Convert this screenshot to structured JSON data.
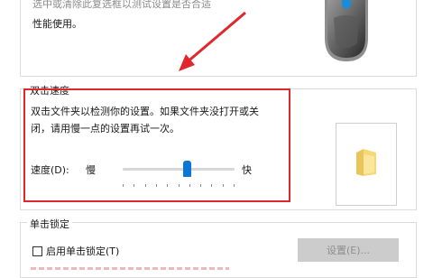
{
  "top_section": {
    "line1": "选中或清除此复选框以测试设置是否合适",
    "line2": "性能使用。"
  },
  "double_click": {
    "group_title": "双击速度",
    "desc_line1": "双击文件夹以检测你的设置。如果文件夹没打开或关",
    "desc_line2": "闭，请用慢一点的设置再试一次。",
    "speed_label": "速度(D):",
    "slow_label": "慢",
    "fast_label": "快",
    "slider_fraction": 0.58
  },
  "click_lock": {
    "group_title": "单击锁定",
    "checkbox_label": "启用单击锁定(T)",
    "checked": false,
    "settings_label": "设置(E)..."
  },
  "colors": {
    "highlight": "#e0272e",
    "slider_thumb": "#0a76d6"
  }
}
